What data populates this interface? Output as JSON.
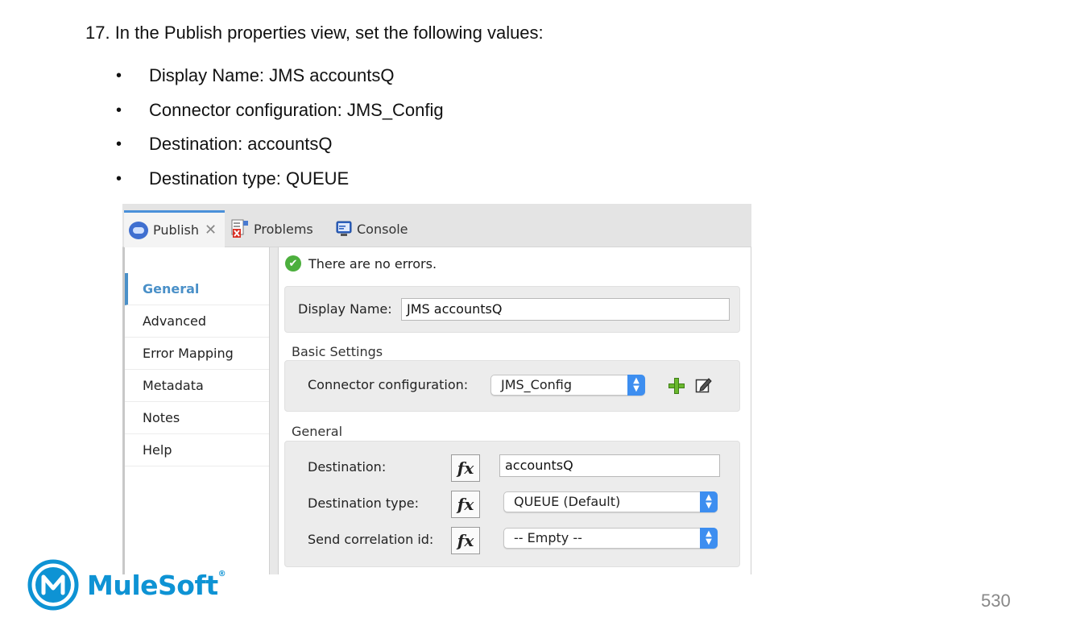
{
  "document": {
    "step": "17. In the Publish properties view, set the following values:",
    "bullets": [
      "Display Name: JMS accountsQ",
      "Connector configuration: JMS_Config",
      "Destination: accountsQ",
      "Destination type: QUEUE"
    ],
    "bullet_glyph": "•",
    "page_number": "530"
  },
  "screenshot": {
    "tabs": [
      {
        "label": "Publish",
        "icon": "publish-icon",
        "active": true
      },
      {
        "label": "Problems",
        "icon": "problems-icon",
        "active": false
      },
      {
        "label": "Console",
        "icon": "console-icon",
        "active": false
      }
    ],
    "close_glyph": "✕",
    "nav": [
      "General",
      "Advanced",
      "Error Mapping",
      "Metadata",
      "Notes",
      "Help"
    ],
    "nav_active": "General",
    "status": {
      "text": "There are no errors.",
      "icon": "check-icon"
    },
    "display_name": {
      "label": "Display Name:",
      "value": "JMS accountsQ"
    },
    "basic_settings": {
      "title": "Basic Settings",
      "connector_label": "Connector configuration:",
      "connector_value": "JMS_Config"
    },
    "general": {
      "title": "General",
      "fx_label": "fx",
      "destination_label": "Destination:",
      "destination_value": "accountsQ",
      "destination_type_label": "Destination type:",
      "destination_type_value": "QUEUE (Default)",
      "correlation_label": "Send correlation id:",
      "correlation_value": "-- Empty --"
    }
  },
  "logo": {
    "text": "MuleSoft",
    "mark": "M",
    "registered": "®"
  },
  "colors": {
    "accent": "#4a90c8",
    "select_arrow": "#3d8ef0",
    "logo": "#0e93d4",
    "ok": "#4caf3d"
  }
}
